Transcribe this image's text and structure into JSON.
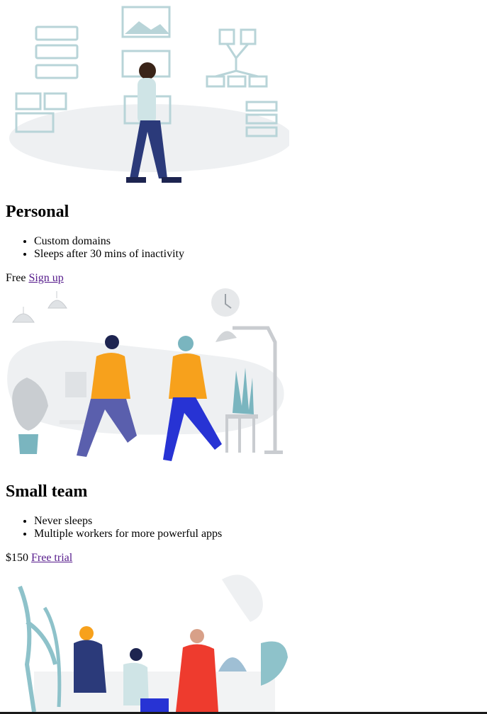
{
  "plans": [
    {
      "illustration": "person-with-wireframes-illustration",
      "title": "Personal",
      "features": [
        "Custom domains",
        "Sleeps after 30 mins of inactivity"
      ],
      "price": "Free",
      "cta": "Sign up"
    },
    {
      "illustration": "two-people-meeting-illustration",
      "title": "Small team",
      "features": [
        "Never sleeps",
        "Multiple workers for more powerful apps"
      ],
      "price": "$150",
      "cta": "Free trial"
    },
    {
      "illustration": "team-of-three-illustration"
    }
  ],
  "colors": {
    "link": "#551a8b",
    "illustration_light": "#b8d4d8",
    "illustration_bg": "#eef0f2",
    "navy": "#2b3a7a",
    "orange": "#f7a11c",
    "red": "#ee3b2e"
  }
}
